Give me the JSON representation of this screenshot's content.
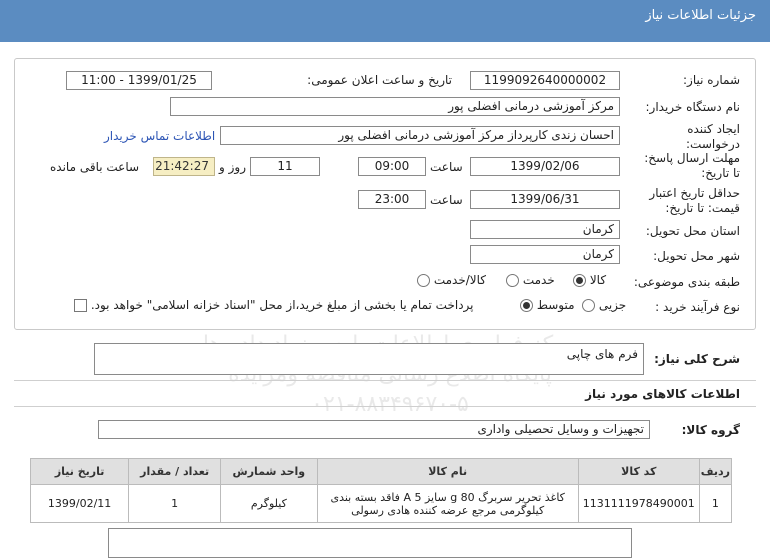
{
  "header": {
    "title": "جزئیات اطلاعات نیاز"
  },
  "form": {
    "need_number_label": "شماره نیاز:",
    "need_number": "1199092640000002",
    "announce_label": "تاریخ و ساعت اعلان عمومی:",
    "announce_value": "1399/01/25 - 11:00",
    "buyer_label": "نام دستگاه خریدار:",
    "buyer_value": "مرکز آموزشی درمانی افضلی پور",
    "creator_label_1": "ایجاد کننده",
    "creator_label_2": "درخواست:",
    "creator_value": "احسان زندی  کارپرداز مرکز آموزشی درمانی افضلی پور",
    "contact_link": "اطلاعات تماس خریدار",
    "deadline_label_1": "مهلت ارسال پاسخ:",
    "deadline_label_2": "تا تاریخ:",
    "deadline_date": "1399/02/06",
    "time_label": "ساعت",
    "deadline_time": "09:00",
    "days_value": "11",
    "days_label": "روز و",
    "remaining_time": "21:42:27",
    "remaining_label": "ساعت باقی مانده",
    "validity_label_1": "حداقل تاریخ اعتبار",
    "validity_label_2": "قیمت: تا تاریخ:",
    "validity_date": "1399/06/31",
    "validity_time": "23:00",
    "province_label": "استان محل تحویل:",
    "province_value": "کرمان",
    "city_label": "شهر محل تحویل:",
    "city_value": "کرمان",
    "category_label": "طبقه بندی موضوعی:",
    "category_options": [
      "کالا",
      "خدمت",
      "کالا/خدمت"
    ],
    "purchase_label": "نوع فرآیند خرید :",
    "purchase_options": [
      "جزیی",
      "متوسط"
    ],
    "payment_note": "پرداخت تمام یا بخشی از مبلغ خرید،از محل \"اسناد خزانه اسلامی\" خواهد بود."
  },
  "summary": {
    "label": "شرح کلی نیاز:",
    "value": "فرم های چاپی"
  },
  "goods_info": {
    "title": "اطلاعات کالاهای مورد نیاز"
  },
  "goods_group": {
    "label": "گروه کالا:",
    "value": "تجهیزات و وسایل تحصیلی واداری"
  },
  "table": {
    "headers": [
      "ردیف",
      "کد کالا",
      "نام کالا",
      "واحد شمارش",
      "تعداد / مقدار",
      "تاریخ نیاز"
    ],
    "rows": [
      [
        "1",
        "1131111978490001",
        "کاغذ تحریر سربرگ 80 g سایز A 5 فاقد بسته بندی کیلوگرمی مرجع عرضه کننده هادی رسولی",
        "کیلوگرم",
        "1",
        "1399/02/11"
      ]
    ]
  },
  "watermark": {
    "line1": "مرکز فراوری اطلاعات پارس نماد داده ها",
    "line2": "پایگاه اطلاع رسانی مناقصه ومزایده",
    "line3": "۰۲۱-۸۸۳۴۹۶۷۰-۵"
  }
}
